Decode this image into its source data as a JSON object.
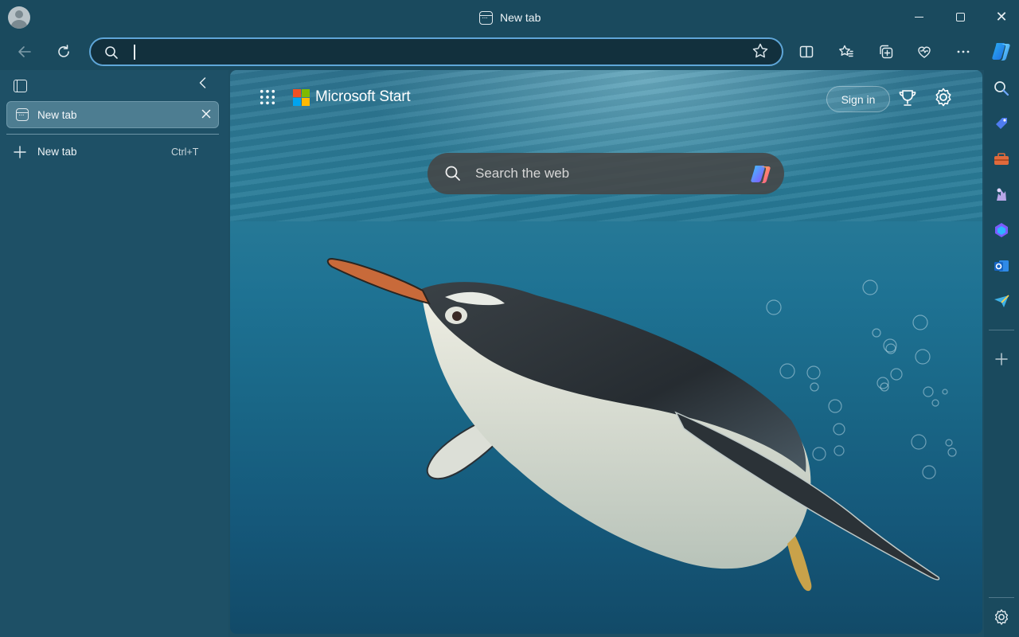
{
  "window": {
    "tab_title": "New tab"
  },
  "toolbar": {
    "address_value": "",
    "icons": [
      "back-icon",
      "refresh-icon",
      "search-icon",
      "favorite-star-icon",
      "split-screen-icon",
      "favorites-icon",
      "collections-icon",
      "browser-essentials-icon",
      "more-icon",
      "copilot-icon"
    ]
  },
  "sidepanel": {
    "tabs": [
      {
        "label": "New tab"
      }
    ],
    "new_tab_label": "New tab",
    "new_tab_shortcut": "Ctrl+T"
  },
  "content": {
    "brand": "Microsoft Start",
    "sign_in": "Sign in",
    "search_placeholder": "Search the web",
    "background": "underwater penguin"
  },
  "rightbar": {
    "icons": [
      "search-icon",
      "shopping-icon",
      "tools-icon",
      "games-icon",
      "microsoft-365-icon",
      "outlook-icon",
      "drop-icon",
      "add-icon",
      "settings-icon"
    ]
  },
  "colors": {
    "frame": "#1a4a5e",
    "panel": "#1e5066",
    "active_tab": "#4d7d91",
    "address_border": "#5fa6d8"
  }
}
